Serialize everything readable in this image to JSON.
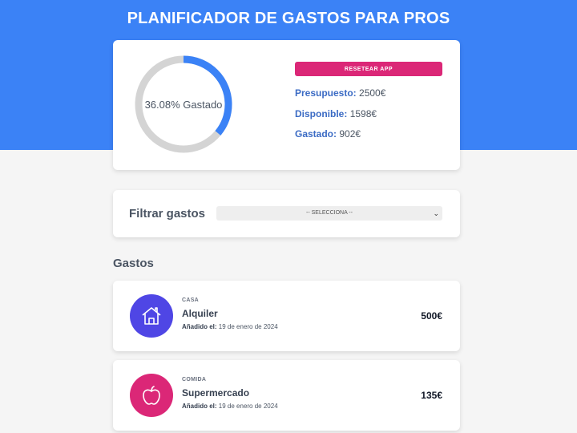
{
  "header": {
    "title": "PLANIFICADOR DE GASTOS PARA PROS"
  },
  "budget": {
    "spent_fraction": 0.3608,
    "percent_label": "36.08% Gastado",
    "reset_label": "RESETEAR APP",
    "budget_label": "Presupuesto:",
    "budget_value": "2500€",
    "available_label": "Disponible:",
    "available_value": "1598€",
    "spent_label": "Gastado:",
    "spent_value": "902€",
    "colors": {
      "progress": "#3b82f6",
      "track": "#d4d4d4"
    }
  },
  "filter": {
    "label": "Filtrar gastos",
    "selected": "-- SELECCIONA --"
  },
  "expenses_section": {
    "title": "Gastos",
    "items": [
      {
        "category": "CASA",
        "name": "Alquiler",
        "date_label": "Añadido el:",
        "date_value": "19 de enero de 2024",
        "amount": "500€",
        "icon": "house-icon",
        "icon_color": "#4f46e5"
      },
      {
        "category": "COMIDA",
        "name": "Supermercado",
        "date_label": "Añadido el:",
        "date_value": "19 de enero de 2024",
        "amount": "135€",
        "icon": "apple-icon",
        "icon_color": "#db2777"
      }
    ]
  }
}
